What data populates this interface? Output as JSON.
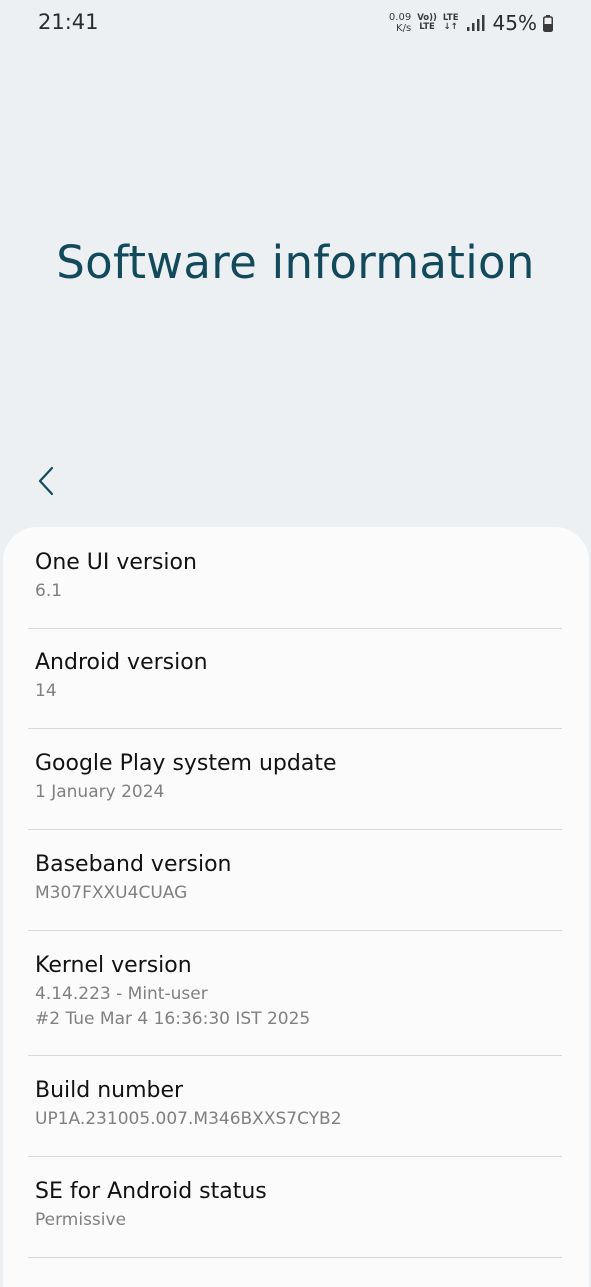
{
  "status": {
    "time": "21:41",
    "speed_value": "0.09",
    "speed_unit": "K/s",
    "volte_top": "Vo))",
    "volte_bottom": "LTE",
    "lte_label": "LTE",
    "lte_arrows": "↓↑",
    "battery": "45%"
  },
  "header": {
    "title": "Software information"
  },
  "items": [
    {
      "title": "One UI version",
      "value": "6.1",
      "value2": ""
    },
    {
      "title": "Android version",
      "value": "14",
      "value2": ""
    },
    {
      "title": "Google Play system update",
      "value": "1 January 2024",
      "value2": ""
    },
    {
      "title": "Baseband version",
      "value": "M307FXXU4CUAG",
      "value2": ""
    },
    {
      "title": "Kernel version",
      "value": "4.14.223 - Mint-user",
      "value2": "#2 Tue Mar 4 16:36:30 IST 2025"
    },
    {
      "title": "Build number",
      "value": "UP1A.231005.007.M346BXXS7CYB2",
      "value2": ""
    },
    {
      "title": "SE for Android status",
      "value": "Permissive",
      "value2": ""
    }
  ]
}
